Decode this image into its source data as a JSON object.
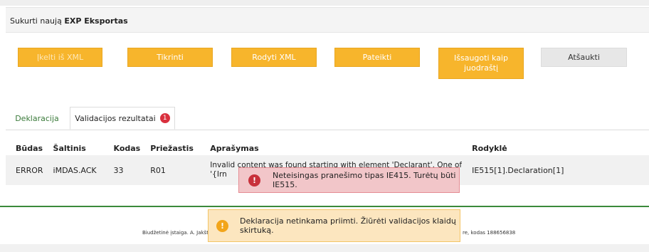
{
  "header": {
    "title_prefix": "Sukurti naują",
    "title_bold": "EXP Eksportas"
  },
  "toolbar": {
    "upload_xml": "Įkelti iš XML",
    "check": "Tikrinti",
    "show_xml": "Rodyti XML",
    "submit": "Pateikti",
    "save_draft": "Išsaugoti kaip juodraštį",
    "cancel": "Atšaukti"
  },
  "tabs": {
    "declaration": "Deklaracija",
    "validation_results": "Validacijos rezultatai",
    "validation_count": "1"
  },
  "table": {
    "headers": [
      "Būdas",
      "Šaltinis",
      "Kodas",
      "Priežastis",
      "Aprašymas",
      "Rodyklė"
    ],
    "rows": [
      {
        "mode": "ERROR",
        "source": "iMDAS.ACK",
        "code": "33",
        "reason": "R01",
        "description_line1": "Invalid content was found starting with element 'Declarant'. One of",
        "description_line2": "'{Irn",
        "pointer": "IE515[1].Declaration[1]"
      }
    ]
  },
  "footer": {
    "left_text": "Biudžetinė įstaiga. A. Jakšto",
    "right_text": "re, kodas 188656838"
  },
  "toasts": {
    "error": "Neteisingas pranešimo tipas IE415. Turėtų būti IE515.",
    "warning": "Deklaracija netinkama priimti. Žiūrėti validacijos klaidų skirtuką."
  },
  "colors": {
    "accent": "#f7b52c",
    "tab_link": "#3a7a3a",
    "error_badge": "#d9303e",
    "footer_line": "#3b8a3b"
  },
  "icons": {
    "error_toast": "exclamation-circle-icon",
    "warning_toast": "exclamation-circle-icon"
  }
}
